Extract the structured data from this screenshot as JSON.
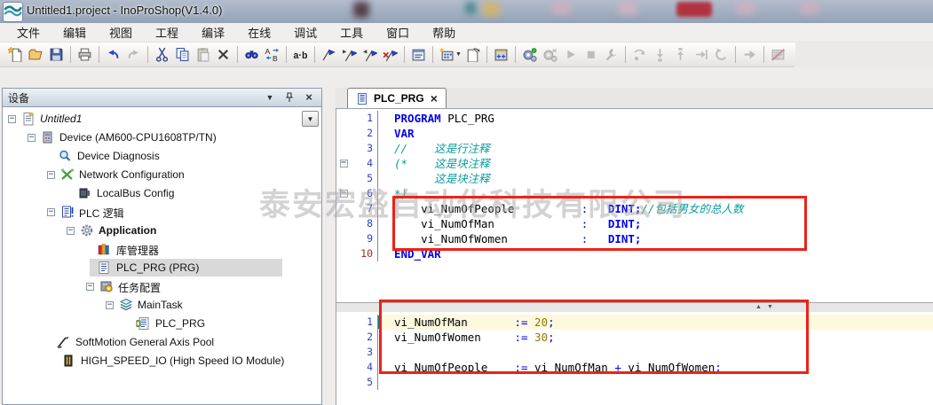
{
  "window": {
    "title": "Untitled1.project - InoProShop(V1.4.0)"
  },
  "menu": {
    "items": [
      "文件",
      "编辑",
      "视图",
      "工程",
      "编译",
      "在线",
      "调试",
      "工具",
      "窗口",
      "帮助"
    ]
  },
  "toolbar": {
    "buttons": [
      "new-project",
      "open-project",
      "save",
      "print",
      "undo",
      "redo",
      "cut",
      "copy",
      "paste",
      "delete",
      "find",
      "replace",
      "find-next-ab",
      "toggle-bookmark",
      "next-bookmark",
      "previous-bookmark",
      "clear-bookmarks",
      "properties",
      "add-device",
      "paste-object",
      "build",
      "login",
      "logout",
      "start",
      "stop",
      "online-config",
      "step-over",
      "step-into",
      "step-out",
      "run-to-cursor",
      "reset",
      "show-next-statement",
      "flow-control"
    ]
  },
  "icons": {
    "minus": "−",
    "chevron_down": "▼",
    "close": "×",
    "up": "▲",
    "down": "▼"
  },
  "device_panel": {
    "title": "设备",
    "tree": [
      {
        "label": "Untitled1"
      },
      {
        "label": "Device (AM600-CPU1608TP/TN)"
      },
      {
        "label": "Device Diagnosis"
      },
      {
        "label": "Network Configuration"
      },
      {
        "label": "LocalBus Config"
      },
      {
        "label": "PLC 逻辑"
      },
      {
        "label": "Application"
      },
      {
        "label": "库管理器"
      },
      {
        "label": "PLC_PRG (PRG)"
      },
      {
        "label": "任务配置"
      },
      {
        "label": "MainTask"
      },
      {
        "label": "PLC_PRG"
      },
      {
        "label": "SoftMotion General Axis Pool"
      },
      {
        "label": "HIGH_SPEED_IO (High Speed IO Module)"
      }
    ]
  },
  "editor": {
    "tab_label": "PLC_PRG",
    "decl": {
      "lines": [
        {
          "n": "1",
          "a": "PROGRAM",
          "b": " PLC_PRG"
        },
        {
          "n": "2",
          "a": "VAR"
        },
        {
          "n": "3",
          "c": "//    这是行注释"
        },
        {
          "n": "4",
          "fold": "−",
          "c": "(*    这是块注释"
        },
        {
          "n": "5",
          "c": "      这是块注释"
        },
        {
          "n": "6",
          "fold": "−",
          "c": "*)"
        },
        {
          "n": "7",
          "b": "    vi_NumOfPeople          ",
          "o": ":   ",
          "a": "DINT;",
          "c": "//包括男女的总人数"
        },
        {
          "n": "8",
          "b": "    vi_NumOfMan             ",
          "o": ":   ",
          "a": "DINT;"
        },
        {
          "n": "9",
          "b": "    vi_NumOfWomen           ",
          "o": ":   ",
          "a": "DINT;"
        },
        {
          "n": "10",
          "a": "END_VAR"
        }
      ]
    },
    "impl": {
      "lines": [
        {
          "n": "1",
          "b": "vi_NumOfMan       ",
          "o": ":= ",
          "num": "20",
          "o2": ";"
        },
        {
          "n": "2",
          "b": "vi_NumOfWomen     ",
          "o": ":= ",
          "num": "30",
          "o2": ";"
        },
        {
          "n": "3"
        },
        {
          "n": "4",
          "b": "vi_NumOfPeople    ",
          "o": ":= ",
          "b2": "vi_NumOfMan",
          "o2": " + ",
          "b3": "vi_NumOfWomen",
          "o3": ";"
        },
        {
          "n": "5"
        }
      ]
    }
  },
  "watermark": "泰安宏盛自动化科技有限公司",
  "colors": {
    "keyword": "#0000ee",
    "comment": "#0a9b9b",
    "number_literal": "#8f7a00",
    "current_line": "#fcf9dd",
    "highlight_box": "#ec2218",
    "panel_header": "#c9d4df"
  }
}
